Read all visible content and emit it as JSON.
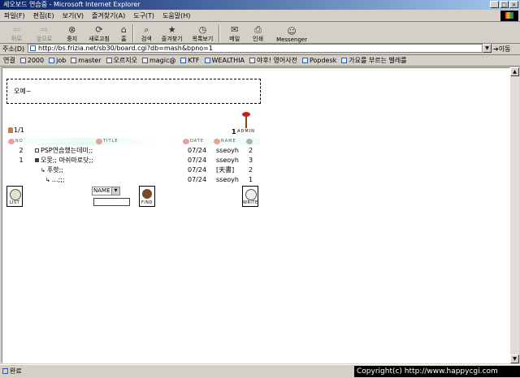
{
  "window": {
    "title": "세오보드 연습중 - Microsoft Internet Explorer",
    "buttons": [
      "_",
      "□",
      "×"
    ]
  },
  "menu": [
    "파일(F)",
    "편집(E)",
    "보기(V)",
    "즐겨찾기(A)",
    "도구(T)",
    "도움말(H)"
  ],
  "toolbar": {
    "back": "뒤로",
    "forward": "앞으로",
    "stop": "중지",
    "refresh": "새로고침",
    "home": "홈",
    "search": "검색",
    "favorites": "즐겨찾기",
    "history": "목록보기",
    "mail": "메일",
    "print": "인쇄",
    "messenger": "Messenger"
  },
  "address": {
    "label": "주소(D)",
    "url": "http://bs.frizia.net/sb30/board.cgi?db=mash&bpno=1",
    "go": "이동"
  },
  "links": {
    "label": "연결",
    "items": [
      "2000",
      "job",
      "master",
      "오르지오",
      "magic@",
      "KTF",
      "WEALTHIA",
      "야후! 영어사전",
      "Popdesk",
      "가요를 부르는 벨레를"
    ]
  },
  "board": {
    "notice": "오예~",
    "page": "1/1",
    "admin_count": "1",
    "admin_label": "ADMIN",
    "headers": {
      "no": "NO",
      "title": "TITLE",
      "date": "DATE",
      "name": "NAME"
    },
    "rows": [
      {
        "no": "2",
        "title": "PSP연습했는데미;;",
        "date": "07/24",
        "name": "sseoyh",
        "hit": "2"
      },
      {
        "no": "1",
        "title": "오못;; 마쉬마로닷;;",
        "date": "07/24",
        "name": "sseoyh",
        "hit": "3"
      },
      {
        "no": "",
        "title": "푸핫;;",
        "date": "07/24",
        "name": "[天書]",
        "hit": "2"
      },
      {
        "no": "",
        "title": "...;;;",
        "date": "07/24",
        "name": "sseoyh",
        "hit": "1"
      }
    ],
    "list_label": "LIST",
    "find_label": "FIND",
    "write_label": "WRITE",
    "search_field": "NAME"
  },
  "status": {
    "text": "완료",
    "copyright": "Copyright(c) http://www.happycgi.com"
  }
}
